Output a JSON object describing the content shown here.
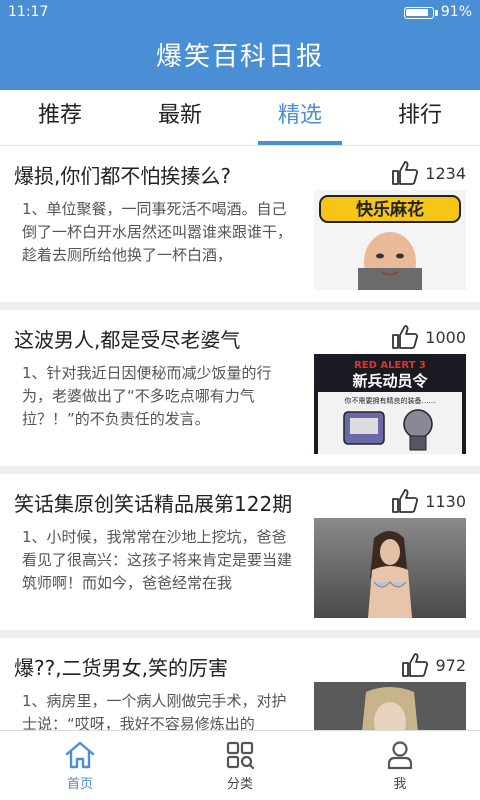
{
  "status": {
    "time": "11:17",
    "battery": "91%",
    "battery_level": 0.91
  },
  "app": {
    "title": "爆笑百科日报"
  },
  "tabs": [
    {
      "label": "推荐"
    },
    {
      "label": "最新"
    },
    {
      "label": "精选",
      "active": true
    },
    {
      "label": "排行"
    }
  ],
  "articles": [
    {
      "title": "爆损,你们都不怕挨揍么?",
      "likes": "1234",
      "excerpt": "1、单位聚餐，一同事死活不喝酒。自己倒了一杯白开水居然还叫嚣谁来跟谁干，趁着去厕所给他换了一杯白酒，",
      "thumb_text": "快乐麻花"
    },
    {
      "title": "这波男人,都是受尽老婆气",
      "likes": "1000",
      "excerpt": "1、针对我近日因便秘而减少饭量的行为，老婆做出了“不多吃点哪有力气拉？！”的不负责任的发言。",
      "thumb_text": "RED ALERT 3",
      "thumb_text2": "新兵动员令",
      "thumb_text3": "你不需要拥有精良的装备……"
    },
    {
      "title": "笑话集原创笑话精品展第122期",
      "likes": "1130",
      "excerpt": "1、小时候，我常常在沙地上挖坑，爸爸看见了很高兴：这孩子将来肯定是要当建筑师啊！而如今，爸爸经常在我"
    },
    {
      "title": "爆??,二货男女,笑的厉害",
      "likes": "972",
      "excerpt": "1、病房里，一个病人刚做完手术，对护士说：“哎呀，我好不容易修炼出的"
    }
  ],
  "bottom_nav": [
    {
      "label": "首页",
      "icon": "home-icon",
      "active": true
    },
    {
      "label": "分类",
      "icon": "category-icon"
    },
    {
      "label": "我",
      "icon": "user-icon"
    }
  ],
  "colors": {
    "primary": "#4a8fd6",
    "background": "#eeeeee"
  }
}
